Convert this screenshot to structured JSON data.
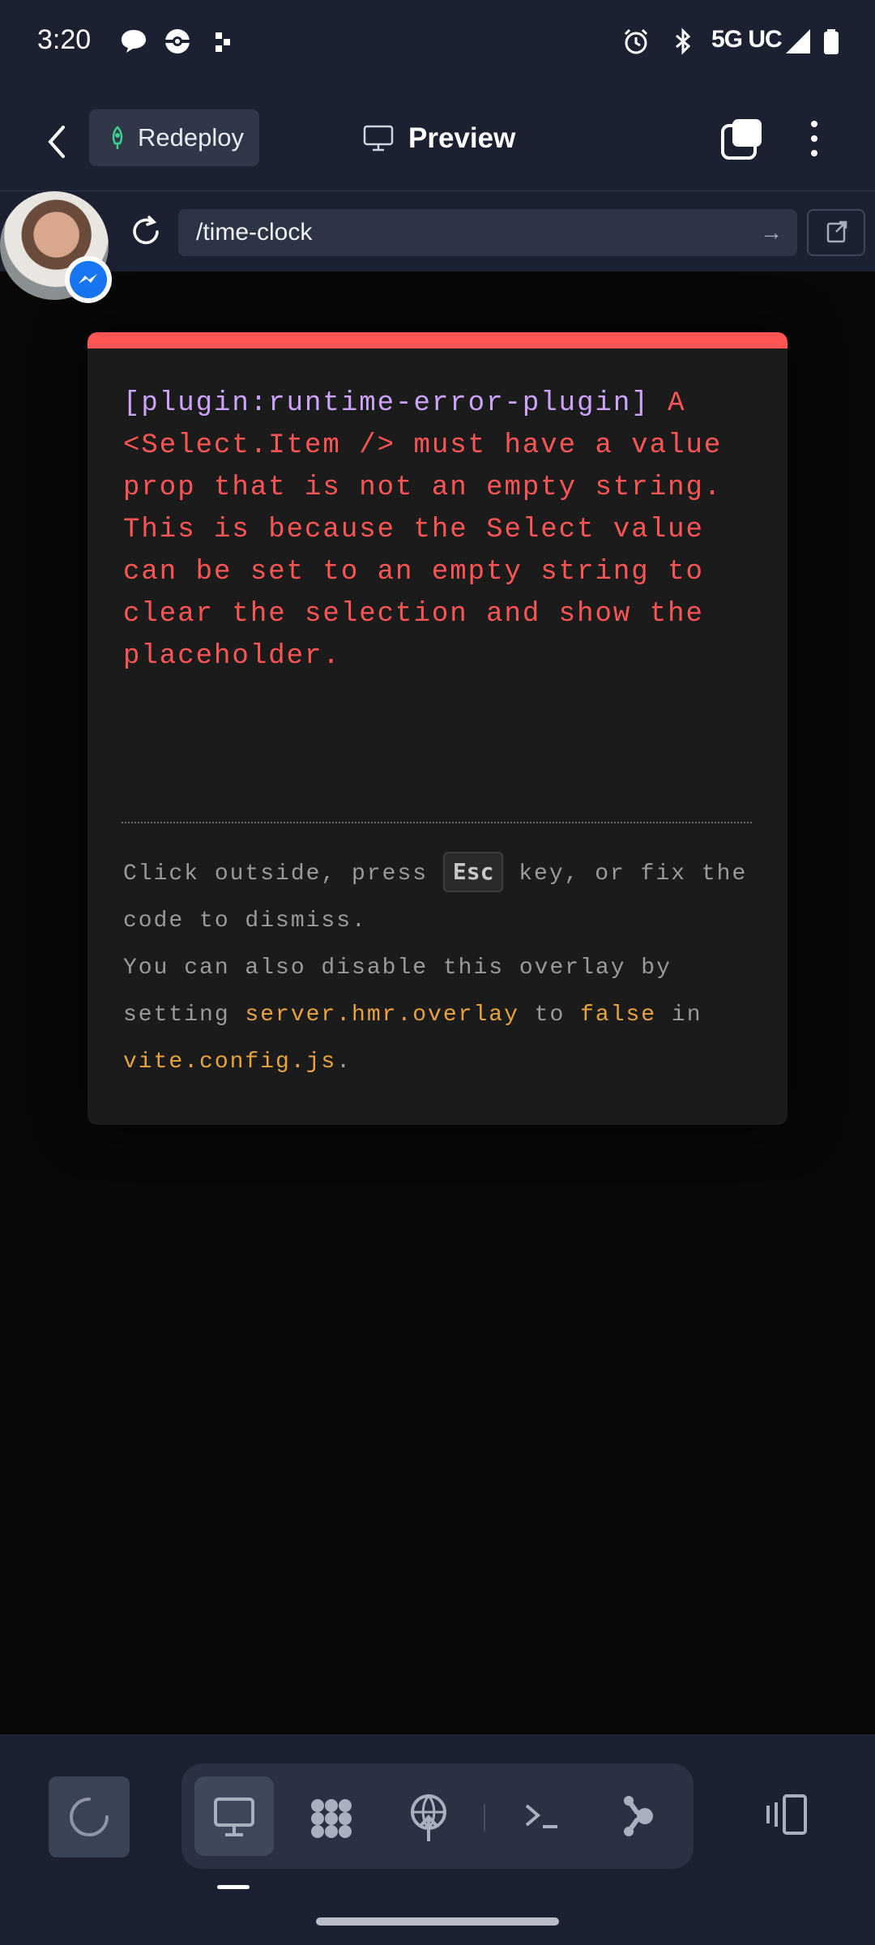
{
  "status_bar": {
    "time": "3:20",
    "network": "5G UC",
    "icons": [
      "chat-bubble-icon",
      "pokeball-icon",
      "dots-grid-icon",
      "alarm-icon",
      "bluetooth-icon",
      "signal-icon",
      "battery-icon"
    ]
  },
  "appbar": {
    "redeploy_label": "Redeploy",
    "preview_label": "Preview"
  },
  "urlbar": {
    "path": "/time-clock",
    "go_glyph": "→"
  },
  "error_overlay": {
    "accent_color": "#ff5555",
    "plugin": "[plugin:runtime-error-plugin]",
    "message": "A <Select.Item /> must have a value prop that is not an empty string. This is because the Select value can be set to an empty string to clear the selection and show the placeholder.",
    "tip_line1_before": "Click outside, press ",
    "tip_key": "Esc",
    "tip_line1_after": " key, or fix the code to dismiss.",
    "tip_line2_before": "You can also disable this overlay by setting ",
    "tip_code1": "server.hmr.overlay",
    "tip_line2_mid": " to ",
    "tip_code2": "false",
    "tip_line2_in": " in ",
    "tip_code3": "vite.config.js",
    "tip_line2_end": "."
  },
  "bottom_toolbar": {
    "tools": [
      "monitor-icon",
      "packages-icon",
      "deploy-icon",
      "terminal-icon",
      "git-icon"
    ],
    "active_tool": "monitor-icon"
  }
}
